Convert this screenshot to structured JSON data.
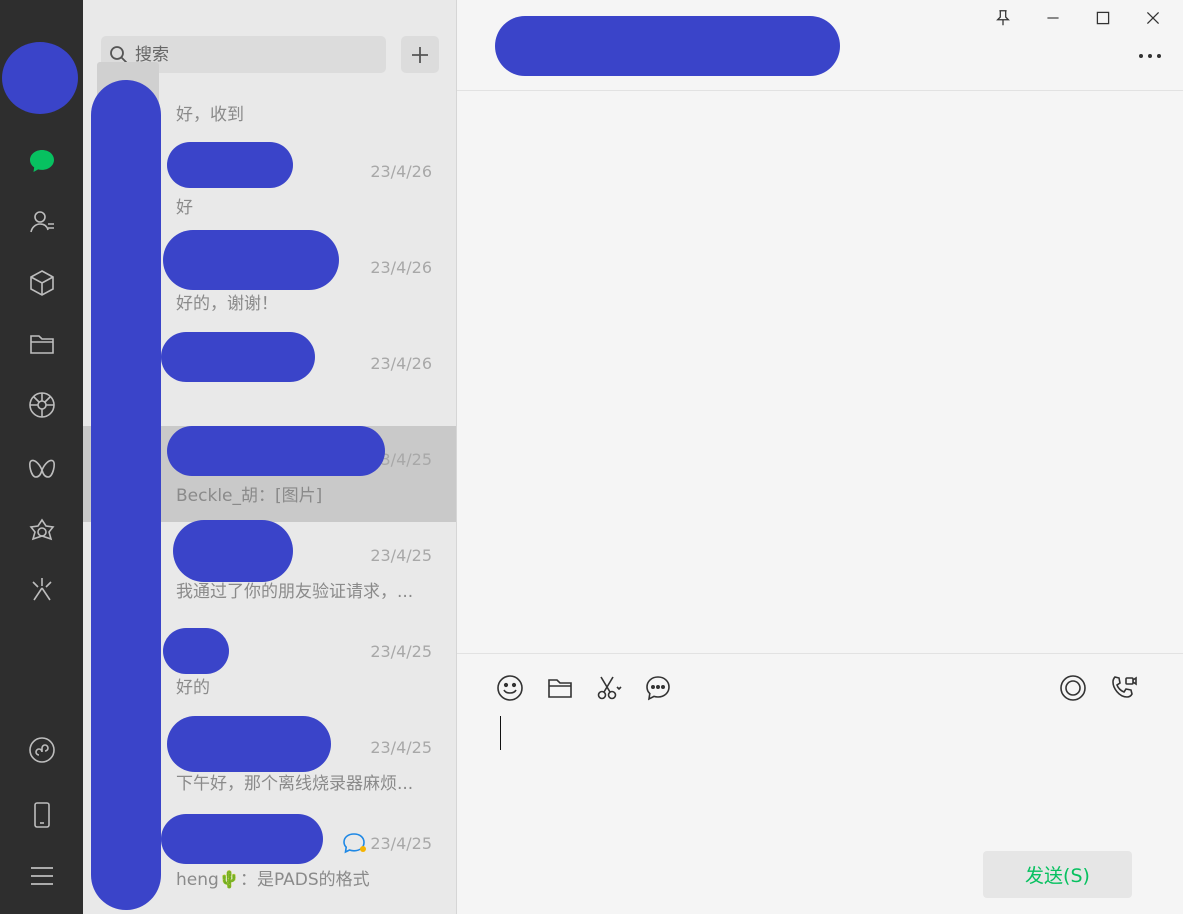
{
  "search": {
    "placeholder": "搜索"
  },
  "chats": [
    {
      "name": "",
      "time": "",
      "preview": "好，收到"
    },
    {
      "name": "",
      "time": "23/4/26",
      "preview": "好"
    },
    {
      "name": "",
      "time": "23/4/26",
      "preview": "好的，谢谢！"
    },
    {
      "name": "",
      "time": "23/4/26",
      "preview": ""
    },
    {
      "name": "",
      "time": "23/4/25",
      "preview": "Beckle_胡：[图片]",
      "selected": true
    },
    {
      "name": "",
      "time": "23/4/25",
      "preview": "我通过了你的朋友验证请求，..."
    },
    {
      "name": "",
      "time": "23/4/25",
      "preview": "好的"
    },
    {
      "name": "",
      "time": "23/4/25",
      "preview": "下午好，那个离线烧录器麻烦..."
    },
    {
      "name": "",
      "time": "23/4/25",
      "preview": "heng🌵：是PADS的格式"
    }
  ],
  "composer": {
    "send_label": "发送(S)"
  },
  "colors": {
    "accent": "#07c160",
    "rail": "#2e2e2e",
    "selected_row": "#c9c9c9"
  },
  "icons": {
    "rail": [
      "chat-icon",
      "contacts-icon",
      "favorites-icon",
      "files-icon",
      "moments-icon",
      "channels-icon",
      "look-icon",
      "search-feature-icon",
      "mini-programs-icon",
      "phone-icon",
      "menu-icon"
    ],
    "toolbar": [
      "emoji-icon",
      "folder-icon",
      "screenshot-icon",
      "chat-history-icon",
      "live-icon",
      "call-icon"
    ],
    "window": [
      "pin-icon",
      "minimize-icon",
      "maximize-icon",
      "close-icon",
      "more-icon"
    ]
  }
}
